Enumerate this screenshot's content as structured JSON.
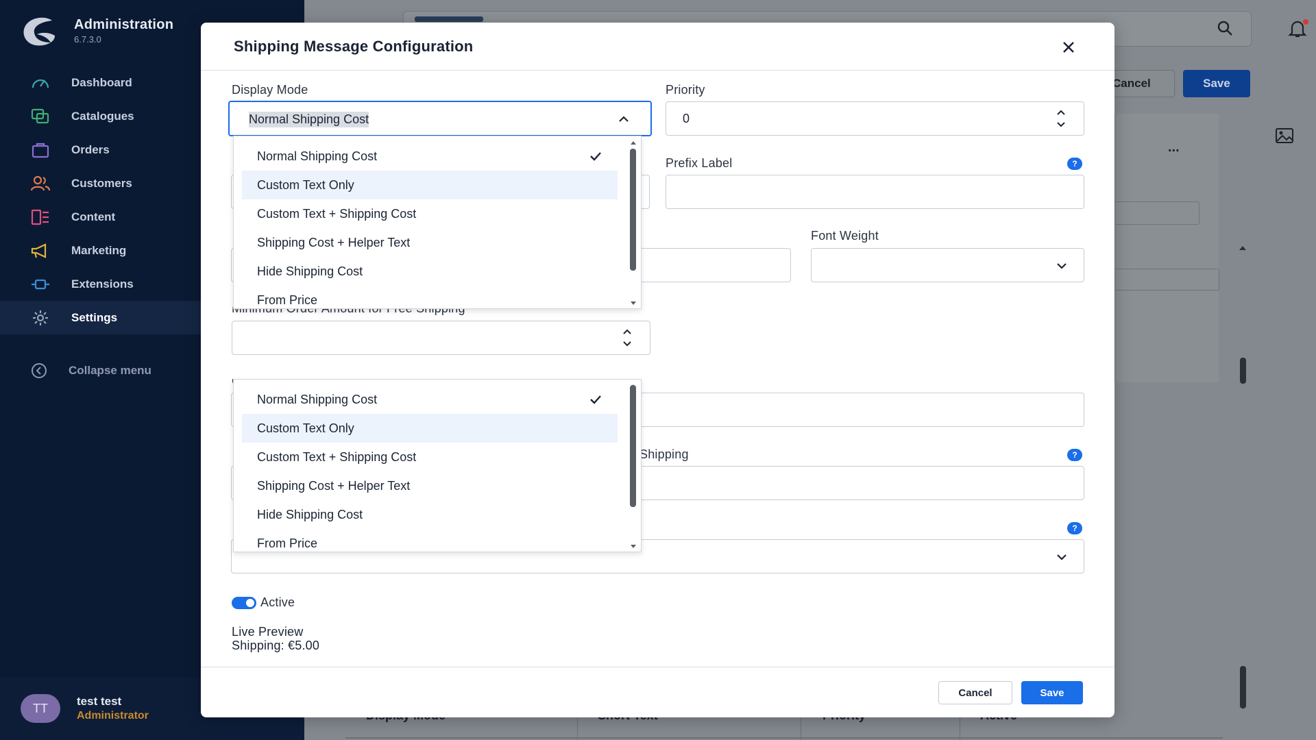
{
  "sidebar": {
    "app_title": "Administration",
    "version": "6.7.3.0",
    "items": [
      {
        "label": "Dashboard",
        "icon": "gauge-icon"
      },
      {
        "label": "Catalogues",
        "icon": "catalogue-icon"
      },
      {
        "label": "Orders",
        "icon": "bag-icon"
      },
      {
        "label": "Customers",
        "icon": "users-icon"
      },
      {
        "label": "Content",
        "icon": "content-icon"
      },
      {
        "label": "Marketing",
        "icon": "megaphone-icon"
      },
      {
        "label": "Extensions",
        "icon": "plug-icon"
      },
      {
        "label": "Settings",
        "icon": "gear-icon"
      }
    ],
    "collapse_label": "Collapse menu",
    "user": {
      "initials": "TT",
      "name": "test test",
      "role": "Administrator"
    }
  },
  "background": {
    "cancel_label": "Cancel",
    "save_label": "Save",
    "more_label": "...",
    "table_headers": [
      "Display Mode",
      "Short Text",
      "Priority",
      "Active"
    ]
  },
  "modal": {
    "title": "Shipping Message Configuration",
    "display_mode": {
      "label": "Display Mode",
      "value": "Normal Shipping Cost"
    },
    "priority": {
      "label": "Priority",
      "value": "0"
    },
    "prefix_label": {
      "label": "Prefix Label"
    },
    "font_weight": {
      "label": "Font Weight"
    },
    "min_order": {
      "label": "Minimum Order Amount for Free Shipping"
    },
    "custom_free": {
      "label": "Custom Message When Customer Qualifies for Free Shipping"
    },
    "shipping_label_fragment": "Shipping",
    "options": [
      "Normal Shipping Cost",
      "Custom Text Only",
      "Custom Text + Shipping Cost",
      "Shipping Cost + Helper Text",
      "Hide Shipping Cost",
      "From Price"
    ],
    "active_label": "Active",
    "preview_title": "Live Preview",
    "preview_text": "Shipping: €5.00",
    "cancel_label": "Cancel",
    "save_label": "Save"
  },
  "colors": {
    "sidebar_bg": "#0b1a33",
    "accent": "#1a6ee8",
    "highlight": "#edf3fd",
    "role": "#c98a2e"
  }
}
